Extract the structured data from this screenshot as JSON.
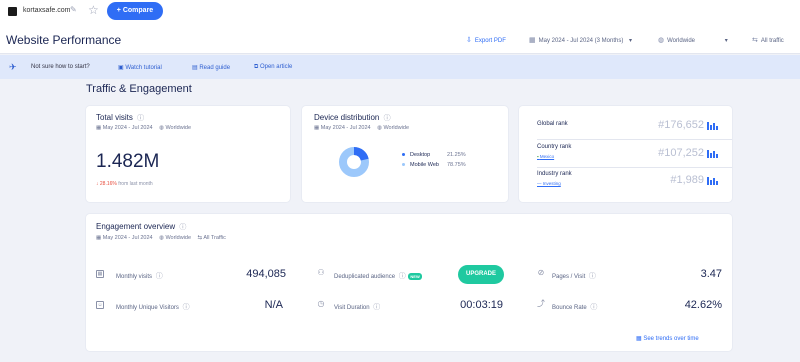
{
  "topbar": {
    "domain": "kortaxsafe.com",
    "compare_label": "Compare",
    "icons": {
      "favicon": "site-favicon",
      "edit": "pencil-icon",
      "star": "star-icon",
      "compare": "plus-icon"
    }
  },
  "header": {
    "title": "Website Performance",
    "export_label": "Export PDF",
    "date_range": "May 2024 - Jul 2024 (3 Months)",
    "region": "Worldwide",
    "traffic": "All traffic"
  },
  "banner": {
    "question": "Not sure how to start?",
    "watch": "Watch tutorial",
    "read": "Read guide",
    "open": "Open article"
  },
  "section_title": "Traffic & Engagement",
  "total_visits": {
    "title": "Total visits",
    "date": "May 2024 - Jul 2024",
    "region": "Worldwide",
    "value": "1.482M",
    "change": "↓ 28.16%",
    "change_suffix": "from last month"
  },
  "device": {
    "title": "Device distribution",
    "date": "May 2024 - Jul 2024",
    "region": "Worldwide",
    "desktop_label": "Desktop",
    "desktop_pct": "21.25%",
    "desktop_share": 0.2125,
    "mobile_label": "Mobile Web",
    "mobile_pct": "78.75%",
    "colors": {
      "desktop": "#2f6df5",
      "mobile": "#9cc8fb"
    }
  },
  "ranks": {
    "global_label": "Global rank",
    "global_value": "#176,652",
    "country_label": "Country rank",
    "country_sub": "Mexico",
    "country_value": "#107,252",
    "industry_label": "Industry rank",
    "industry_sub": "— Investing",
    "industry_value": "#1,989"
  },
  "engagement": {
    "title": "Engagement overview",
    "date": "May 2024 - Jul 2024",
    "region": "Worldwide",
    "traffic": "All Traffic",
    "monthly_visits_label": "Monthly visits",
    "monthly_visits_value": "494,085",
    "unique_visitors_label": "Monthly Unique Visitors",
    "unique_visitors_value": "N/A",
    "dedup_label": "Deduplicated audience",
    "new_badge": "NEW",
    "upgrade_label": "UPGRADE",
    "duration_label": "Visit Duration",
    "duration_value": "00:03:19",
    "pages_label": "Pages / Visit",
    "pages_value": "3.47",
    "bounce_label": "Bounce Rate",
    "bounce_value": "42.62%",
    "trends_link": "See trends over time"
  },
  "colors": {
    "accent": "#2f6df5",
    "success": "#1fc9a0",
    "negative": "#e74c3c",
    "page_bg": "#f0f2f8"
  }
}
